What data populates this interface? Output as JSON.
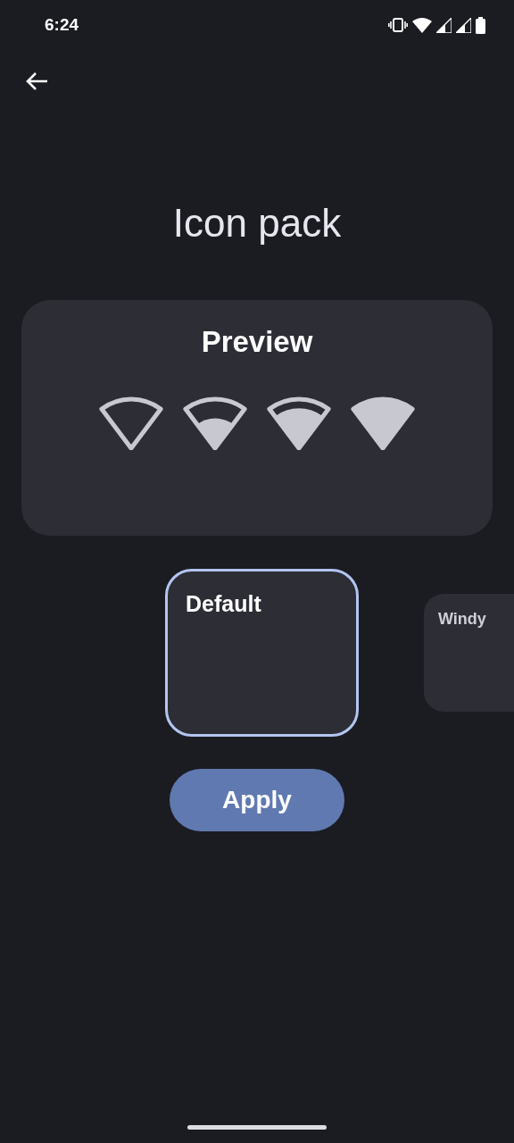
{
  "status_bar": {
    "time": "6:24"
  },
  "title": "Icon pack",
  "preview": {
    "title": "Preview"
  },
  "packs": [
    {
      "label": "Default",
      "selected": true
    },
    {
      "label": "Windy",
      "selected": false
    }
  ],
  "apply_button": "Apply"
}
